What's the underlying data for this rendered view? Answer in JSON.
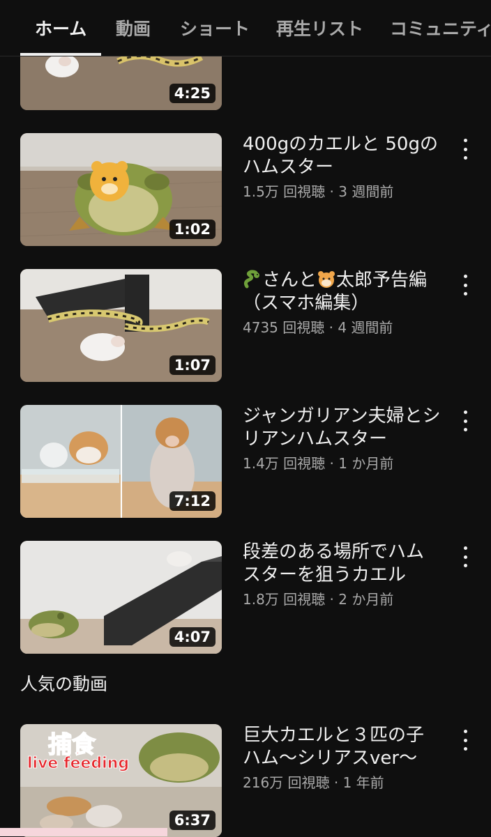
{
  "tabs": [
    {
      "label": "ホーム",
      "active": true
    },
    {
      "label": "動画",
      "active": false
    },
    {
      "label": "ショート",
      "active": false
    },
    {
      "label": "再生リスト",
      "active": false
    },
    {
      "label": "コミュニティ",
      "active": false
    }
  ],
  "videos": [
    {
      "duration": "4:25",
      "title": "",
      "meta": ""
    },
    {
      "duration": "1:02",
      "title": "400gのカエルと 50gのハムスター",
      "meta": "1.5万 回視聴 · 3 週間前"
    },
    {
      "duration": "1:07",
      "title_emoji_1": "snake-emoji",
      "title_part_1": "さんと",
      "title_emoji_2": "hamster-emoji",
      "title_part_2": "太郎予告編（スマホ編集）",
      "meta": "4735 回視聴 · 4 週間前"
    },
    {
      "duration": "7:12",
      "title": "ジャンガリアン夫婦とシリアンハムスター",
      "meta": "1.4万 回視聴 · 1 か月前"
    },
    {
      "duration": "4:07",
      "title": "段差のある場所でハムスターを狙うカエル",
      "meta": "1.8万 回視聴 · 2 か月前"
    }
  ],
  "popular_section": {
    "title": "人気の動画",
    "videos": [
      {
        "duration": "6:37",
        "title": "巨大カエルと３匹の子ハム〜シリアスver〜",
        "meta": "216万 回視聴 · 1 年前",
        "thumb_text_1": "捕食",
        "thumb_text_2": "live feeding"
      }
    ]
  },
  "colors": {
    "background": "#0f0f0f",
    "text": "#f1f1f1",
    "secondary_text": "#aaaaaa"
  }
}
